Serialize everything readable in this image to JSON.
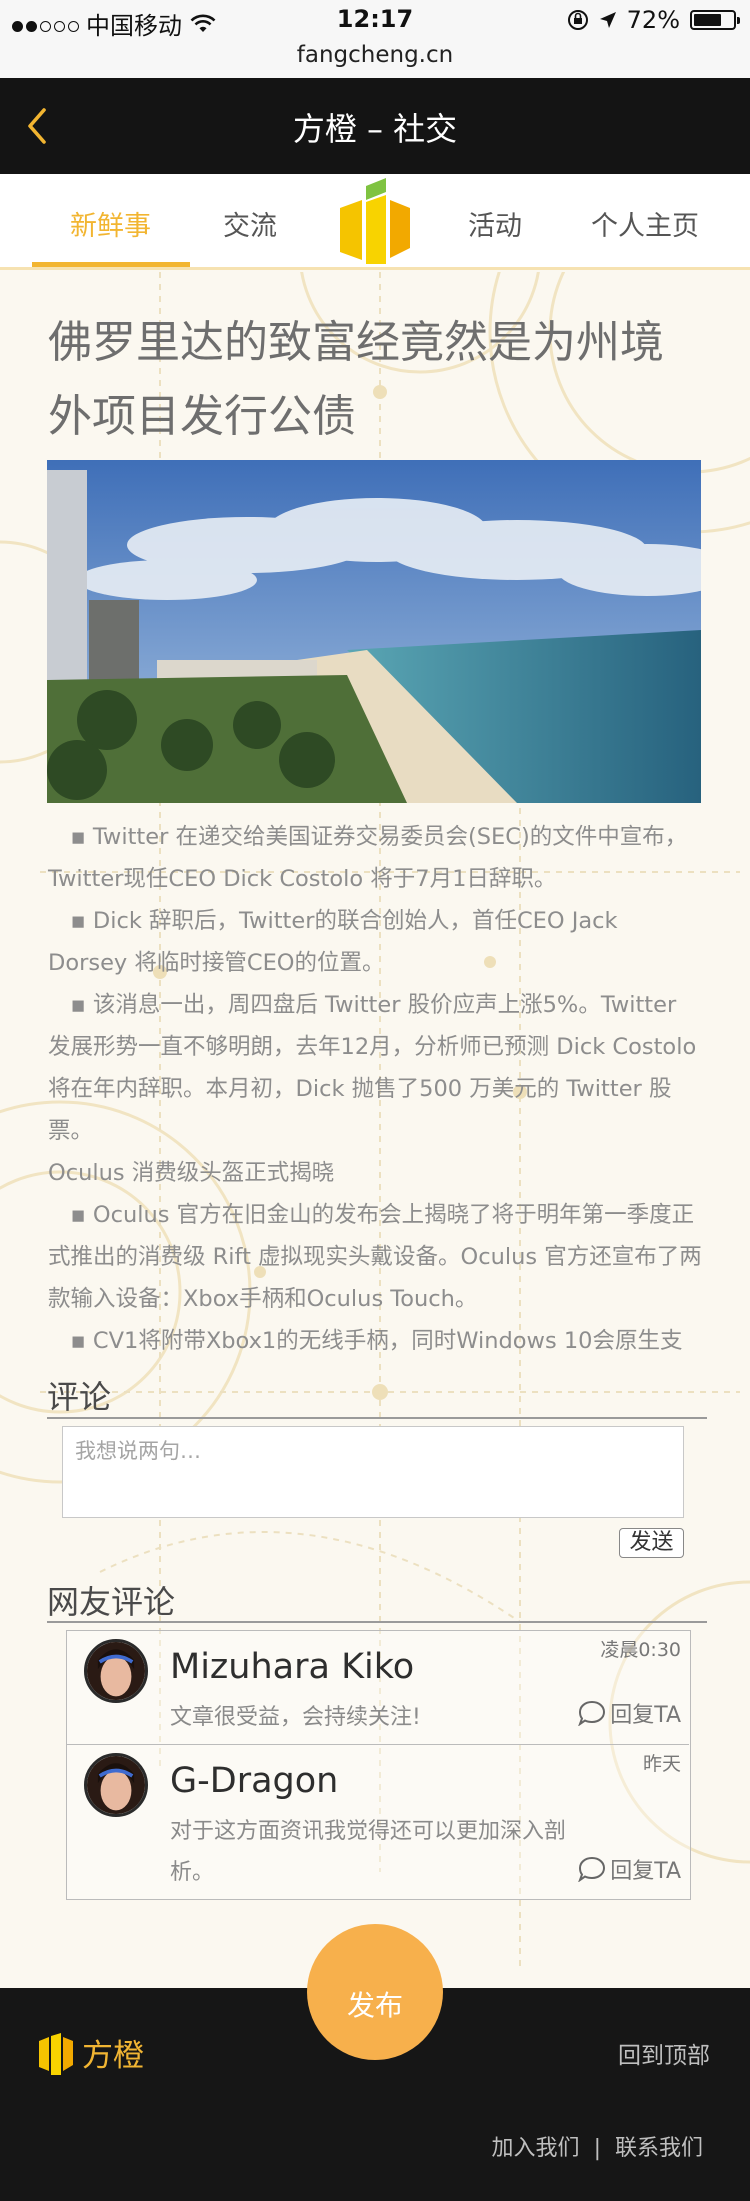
{
  "status_bar": {
    "carrier": "中国移动",
    "time": "12:17",
    "battery": "72%",
    "battery_level": 0.72,
    "url": "fangcheng.cn"
  },
  "header": {
    "title": "方橙 – 社交",
    "back_icon": "chevron-left-icon"
  },
  "tabs": [
    {
      "label": "新鲜事",
      "active": true
    },
    {
      "label": "交流",
      "active": false
    },
    {
      "label": "活动",
      "active": false
    },
    {
      "label": "个人主页",
      "active": false
    }
  ],
  "article": {
    "title": "佛罗里达的致富经竟然是为州境外项目发行公债",
    "paragraphs": [
      "Twitter 在递交给美国证券交易委员会(SEC)的文件中宣布，Twitter现任CEO Dick Costolo 将于7月1日辞职。",
      "Dick 辞职后，Twitter的联合创始人，首任CEO Jack Dorsey 将临时接管CEO的位置。",
      "该消息一出，周四盘后 Twitter 股价应声上涨5%。Twitter 发展形势一直不够明朗，去年12月，分析师已预测 Dick Costolo 将在年内辞职。本月初，Dick 抛售了500 万美元的 Twitter 股票。",
      "Oculus 消费级头盔正式揭晓",
      "Oculus 官方在旧金山的发布会上揭晓了将于明年第一季度正式推出的消费级 Rift 虚拟现实头戴设备。Oculus 官方还宣布了两款输入设备：Xbox手柄和Oculus Touch。",
      "CV1将附带Xbox1的无线手柄，同时Windows 10会原生支"
    ]
  },
  "comments": {
    "title": "评论",
    "placeholder": "我想说两句…",
    "send_label": "发送"
  },
  "reviews": {
    "title": "网友评论",
    "items": [
      {
        "name": "Mizuhara Kiko",
        "time": "凌晨0:30",
        "text": "文章很受益，会持续关注!",
        "reply": "回复TA"
      },
      {
        "name": "G-Dragon",
        "time": "昨天",
        "text": "对于这方面资讯我觉得还可以更加深入剖析。",
        "reply": "回复TA"
      }
    ]
  },
  "publish_label": "发布",
  "footer": {
    "brand": "方橙",
    "back_to_top": "回到顶部",
    "join_us": "加入我们",
    "separator": "|",
    "contact_us": "联系我们"
  },
  "colors": {
    "accent": "#f2b531",
    "publish": "#f7b04c",
    "topbar": "#141414",
    "footer": "#161616",
    "page_bg": "#fbf8f0"
  }
}
